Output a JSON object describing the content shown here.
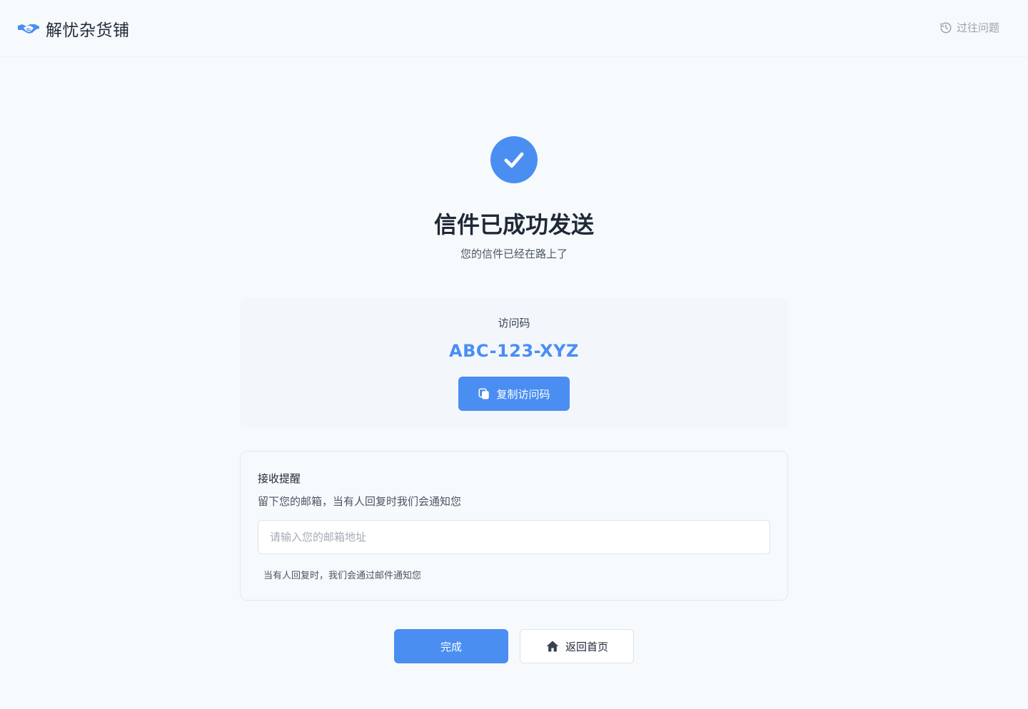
{
  "header": {
    "brand": "解忧杂货铺",
    "history_label": "过往问题"
  },
  "status": {
    "title": "信件已成功发送",
    "subtitle": "您的信件已经在路上了"
  },
  "access_code": {
    "label": "访问码",
    "value": "ABC-123-XYZ",
    "copy_label": "复制访问码"
  },
  "reminder": {
    "title": "接收提醒",
    "description": "留下您的邮箱，当有人回复时我们会通知您",
    "email_value": "",
    "email_placeholder": "请输入您的邮箱地址",
    "note": "当有人回复时，我们会通过邮件通知您"
  },
  "actions": {
    "done_label": "完成",
    "home_label": "返回首页"
  },
  "icons": {
    "logo": "handshake-icon",
    "history": "history-icon",
    "success": "check-icon",
    "copy": "copy-icon",
    "home": "home-icon"
  },
  "colors": {
    "accent": "#4a8ef2",
    "background": "#f7fafd",
    "card": "#f3f7fc"
  }
}
